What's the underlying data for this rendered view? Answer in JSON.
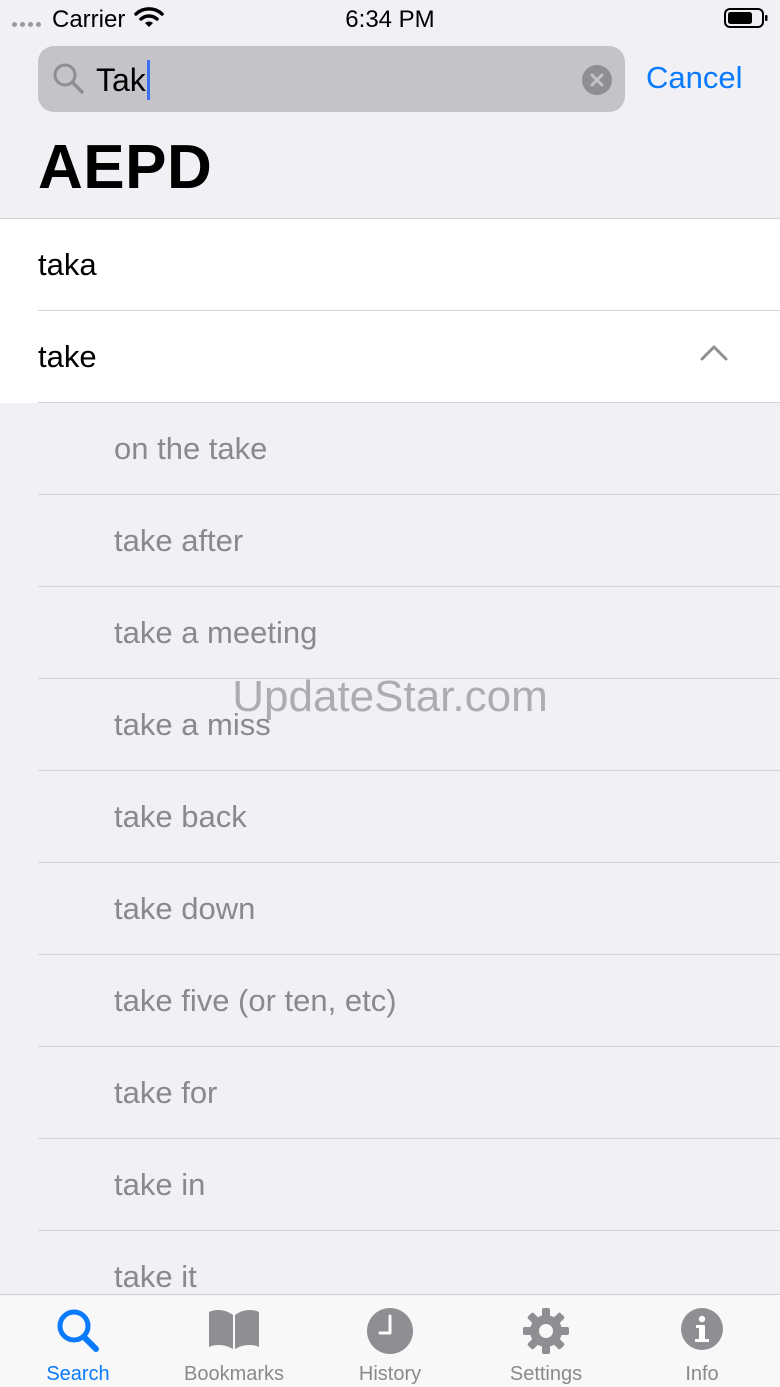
{
  "status_bar": {
    "carrier": "Carrier",
    "time": "6:34 PM"
  },
  "search": {
    "value": "Tak",
    "cancel_label": "Cancel"
  },
  "page": {
    "title": "AEPD"
  },
  "results": [
    {
      "label": "taka",
      "level": "primary"
    },
    {
      "label": "take",
      "level": "primary",
      "expanded": true
    },
    {
      "label": "on the take",
      "level": "sub"
    },
    {
      "label": "take after",
      "level": "sub"
    },
    {
      "label": "take a meeting",
      "level": "sub"
    },
    {
      "label": "take a miss",
      "level": "sub"
    },
    {
      "label": "take back",
      "level": "sub"
    },
    {
      "label": "take down",
      "level": "sub"
    },
    {
      "label": "take five (or ten, etc)",
      "level": "sub"
    },
    {
      "label": "take for",
      "level": "sub"
    },
    {
      "label": "take in",
      "level": "sub"
    },
    {
      "label": "take it",
      "level": "sub"
    }
  ],
  "watermark": "UpdateStar.com",
  "tab_bar": {
    "tabs": [
      {
        "label": "Search",
        "icon": "search-icon",
        "active": true
      },
      {
        "label": "Bookmarks",
        "icon": "book-icon",
        "active": false
      },
      {
        "label": "History",
        "icon": "clock-icon",
        "active": false
      },
      {
        "label": "Settings",
        "icon": "gear-icon",
        "active": false
      },
      {
        "label": "Info",
        "icon": "info-icon",
        "active": false
      }
    ]
  },
  "colors": {
    "accent": "#0a7aff",
    "secondary_text": "#8a8a8e",
    "background": "#f0f0f5"
  }
}
